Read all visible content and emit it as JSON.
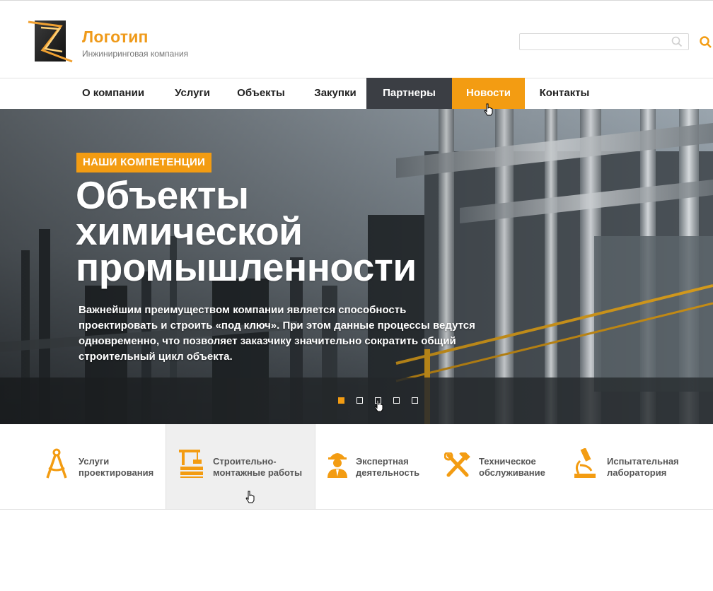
{
  "brand": {
    "title": "Логотип",
    "subtitle": "Инжиниринговая компания"
  },
  "search": {
    "placeholder": "",
    "value": ""
  },
  "nav": {
    "items": [
      {
        "label": "О компании",
        "state": "default"
      },
      {
        "label": "Услуги",
        "state": "default"
      },
      {
        "label": "Объекты",
        "state": "default"
      },
      {
        "label": "Закупки",
        "state": "default"
      },
      {
        "label": "Партнеры",
        "state": "active"
      },
      {
        "label": "Новости",
        "state": "hover"
      },
      {
        "label": "Контакты",
        "state": "default"
      }
    ]
  },
  "hero": {
    "badge": "НАШИ КОМПЕТЕНЦИИ",
    "title_lines": [
      "Объекты",
      "химической",
      "промышленности"
    ],
    "text_lines": [
      "Важнейшим преимуществом компании является способность",
      "проектировать и строить «под ключ». При этом данные процессы ведутся",
      "одновременно, что позволяет заказчику значительно сократить общий",
      "строительный цикл объекта."
    ],
    "slides_total": 5,
    "slide_active": 1
  },
  "services": [
    {
      "line1": "Услуги",
      "line2": "проектирования",
      "icon": "compass-icon"
    },
    {
      "line1": "Строительно-",
      "line2": "монтажные работы",
      "icon": "construction-crane-icon"
    },
    {
      "line1": "Экспертная",
      "line2": "деятельность",
      "icon": "engineer-helmet-icon"
    },
    {
      "line1": "Техническое",
      "line2": "обслуживание",
      "icon": "wrench-hammer-icon"
    },
    {
      "line1": "Испытательная",
      "line2": "лаборатория",
      "icon": "microscope-icon"
    }
  ],
  "colors": {
    "accent": "#f39c12",
    "nav_active_bg": "#3b3e44",
    "text": "#222222",
    "muted": "#777777"
  }
}
